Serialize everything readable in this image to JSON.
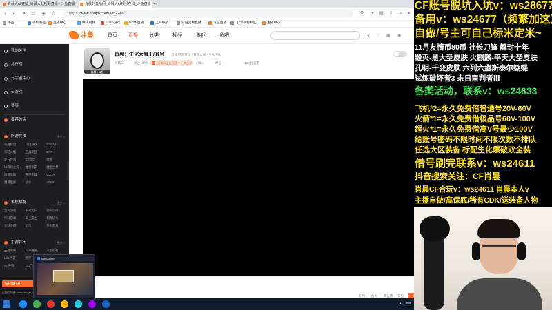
{
  "browser": {
    "tabs": [
      {
        "label": "肖晨大战直播_肖晨大战视频直播 - 斗鱼直播",
        "favicon_color": "#ff7a1c"
      },
      {
        "label": "肖晨的直播间_肖晨大战视频在线_斗鱼直播",
        "favicon_color": "#ff7a1c"
      }
    ],
    "url_scheme": "https://",
    "url": "www.douyu.com/3357246",
    "bookmarks": [
      {
        "label": "书签",
        "color": "#999999"
      },
      {
        "label": "手机书签",
        "color": "#4a90e2"
      },
      {
        "label": "主播中心",
        "color": "#ff7a1c"
      },
      {
        "label": "腾讯视频",
        "color": "#3aa0ff"
      },
      {
        "label": "Flash游戏",
        "color": "#e84a3a"
      },
      {
        "label": "NOW直播",
        "color": "#ffb400"
      },
      {
        "label": "上网导航",
        "color": "#2a7de1"
      },
      {
        "label": "穿越火线直播",
        "color": "#999999"
      },
      {
        "label": "斗鱼直播",
        "color": "#ff7a1c"
      },
      {
        "label": "【CF教程专区】",
        "color": "#999999"
      },
      {
        "label": "主播中心",
        "color": "#ff7a1c"
      }
    ]
  },
  "site": {
    "logo_text": "斗鱼",
    "nav": [
      "首页",
      "直播",
      "分类",
      "视频",
      "游戏",
      "鱼吧"
    ],
    "active_nav": "直播"
  },
  "sidebar": {
    "items": [
      "我的关注",
      "排行榜",
      "元宇宙中心",
      "云游戏",
      "赛事"
    ],
    "section_title": "推荐分类",
    "groups": [
      {
        "title": "网游竞技",
        "more": "更多 >",
        "cells": [
          "英雄联盟",
          "热门游戏",
          "DOTA2",
          "穿越火线",
          "逆战专区",
          "DNF",
          "炉石传说",
          "CS:GO",
          "魔兽",
          "lol云顶之弈",
          "魔兽争霸",
          "魔兽世界",
          "风暴英雄",
          "守望先锋",
          "DOTA",
          "魔兽世界",
          "战争",
          "APEX"
        ]
      },
      {
        "title": "单机热游",
        "more": "更多 >",
        "cells": [
          "主机游戏",
          "永劫无间",
          "使命召唤",
          "怀旧游戏",
          "海上霸主",
          "刺客信条",
          "星际争霸",
          "饥荒",
          "怀旧游戏"
        ]
      },
      {
        "title": "手游休闲",
        "more": "更多 >",
        "cells": [
          "王者荣耀",
          "和平精英",
          "火影忍者",
          "LOL手游",
          "原神",
          "第五人格",
          "CF手游",
          "QQ飞车"
        ]
      }
    ],
    "bottom_button": "客户端打开",
    "bottom_hint": "已应用插件 www.douyu.com"
  },
  "room": {
    "title": "肖晨：生化大魔王/验号",
    "tag": "直播",
    "breadcrumb": "网游竞技 › 穿越火线 › 生化团队",
    "streamer_caption": "肖晨 | 斗鱼",
    "meta": [
      "肖晨三",
      "关注",
      "举报"
    ],
    "badge": "直播间正在直播中，点击送礼",
    "stats": [
      "分享",
      "举报",
      "180 位观看"
    ]
  },
  "player_bar": {
    "items": [
      "礼物",
      "鱼丸",
      "荧光棒",
      "背包"
    ],
    "gift_button": "充值"
  },
  "popup": {
    "title": "WeGame"
  },
  "taskbar": {
    "icon_colors": [
      "#1e90ff",
      "#4caf50",
      "#e53935",
      "#ffb300",
      "#26c6da",
      "#aa00ff",
      "#1565c0"
    ]
  },
  "overlay": {
    "lines": [
      {
        "text": "CF账号脱坑入坑v：ws28677",
        "color": "y"
      },
      {
        "text": "备用v：ws24677（频繁加这）",
        "color": "y"
      },
      {
        "text": "自做/号主可自己标米定米~",
        "color": "y"
      },
      {
        "text": "11月友情币80币    社长刀锋    解封十年",
        "color": "w"
      },
      {
        "text": "毁灭-黑大圣皮肤    火麒麟-平天大圣皮肤",
        "color": "w"
      },
      {
        "text": "孔明-千变皮肤       六列六盘斯泰尔蝴蝶",
        "color": "w"
      },
      {
        "text": "试炼破坏者3 末日审判者Ⅲ",
        "color": "w"
      },
      {
        "text": "各类活动，联系v：ws24633",
        "color": "g"
      },
      {
        "text": "飞机*2=永久免费借普通号20V-60V",
        "color": "y"
      },
      {
        "text": "火箭*1=永久免费借极品号60V-100V",
        "color": "y"
      },
      {
        "text": "超火*1=永久免费借高V号最少100V",
        "color": "y"
      },
      {
        "text": "给账号密码不限时间不限次数不排队",
        "color": "y"
      },
      {
        "text": "任选大区装备 标配生化爆破双全装",
        "color": "y"
      },
      {
        "text": "借号刷完联系v：ws24611",
        "color": "y"
      },
      {
        "text": "抖音搜索关注：CF肖晨",
        "color": "y"
      },
      {
        "text": "肖晨CF合玩v：ws24611  肖晨本人v",
        "color": "y"
      },
      {
        "text": "主播自做/高保底/稀有CDK/送装备人物",
        "color": "y"
      }
    ]
  }
}
